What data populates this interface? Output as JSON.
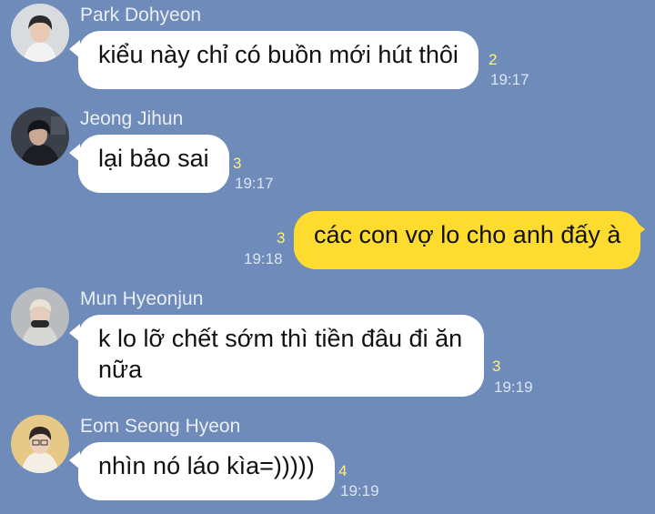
{
  "messages": [
    {
      "sender": "Park Dohyeon",
      "text": "kiểu này chỉ có buồn mới hút thôi",
      "unread": "2",
      "time": "19:17",
      "avatar_icon": "user-avatar-icon"
    },
    {
      "sender": "Jeong Jihun",
      "text": "lại bảo sai",
      "unread": "3",
      "time": "19:17",
      "avatar_icon": "user-avatar-icon"
    },
    {
      "sender": "",
      "text": "các con vợ lo cho anh đấy à",
      "unread": "3",
      "time": "19:18"
    },
    {
      "sender": "Mun Hyeonjun",
      "text": "k lo lỡ chết sớm thì tiền đâu đi ăn nữa",
      "unread": "3",
      "time": "19:19",
      "avatar_icon": "user-avatar-icon"
    },
    {
      "sender": "Eom Seong Hyeon",
      "text": "nhìn nó láo kìa=)))))",
      "unread": "4",
      "time": "19:19",
      "avatar_icon": "user-avatar-icon"
    }
  ],
  "colors": {
    "background": "#6e8bb9",
    "incoming_bubble": "#ffffff",
    "outgoing_bubble": "#fddb2f",
    "unread_count": "#fff176",
    "timestamp": "#dce4f0"
  }
}
